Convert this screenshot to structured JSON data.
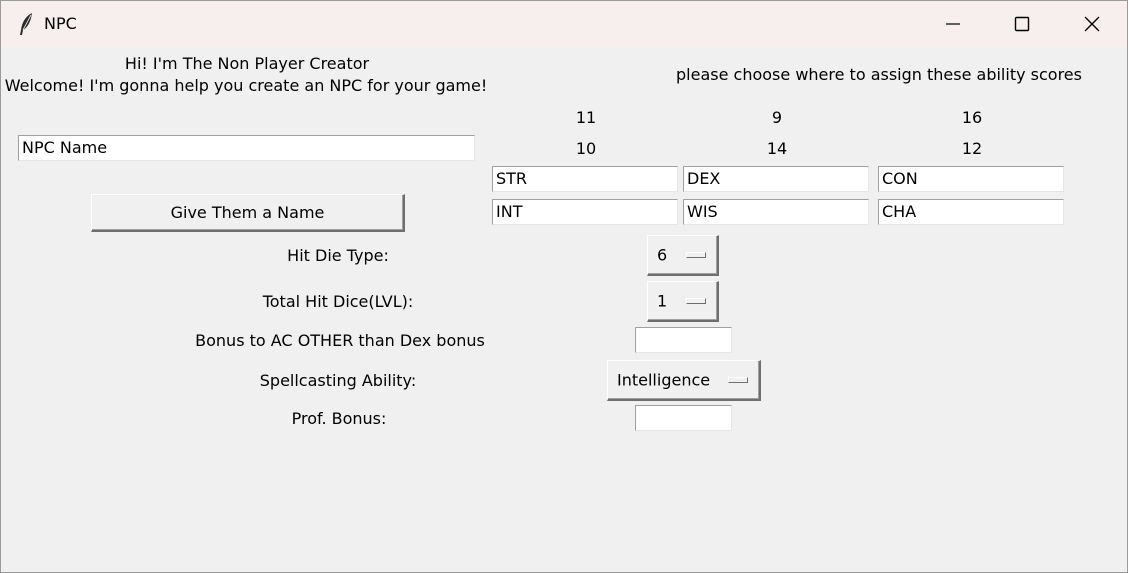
{
  "window": {
    "title": "NPC"
  },
  "intro": {
    "line1": "Hi! I'm The Non Player Creator",
    "line2": "Welcome! I'm gonna help you create an NPC for your game!"
  },
  "abilities": {
    "instruction": "please choose where to assign these ability scores",
    "scores": [
      "11",
      "9",
      "16",
      "10",
      "14",
      "12"
    ],
    "fields": [
      "STR",
      "DEX",
      "CON",
      "INT",
      "WIS",
      "CHA"
    ]
  },
  "name": {
    "field_value": "NPC Name",
    "button_label": "Give Them a Name"
  },
  "hit_die": {
    "label": "Hit Die Type:",
    "value": "6"
  },
  "total_hit_dice": {
    "label": "Total Hit Dice(LVL):",
    "value": "1"
  },
  "ac_bonus": {
    "label": "Bonus to AC OTHER than Dex bonus",
    "value": ""
  },
  "spellcasting": {
    "label": "Spellcasting Ability:",
    "value": "Intelligence"
  },
  "prof_bonus": {
    "label": "Prof. Bonus:",
    "value": ""
  },
  "icons": {
    "app": "feather-icon",
    "minimize": "minimize-icon",
    "maximize": "maximize-icon",
    "close": "close-icon"
  }
}
